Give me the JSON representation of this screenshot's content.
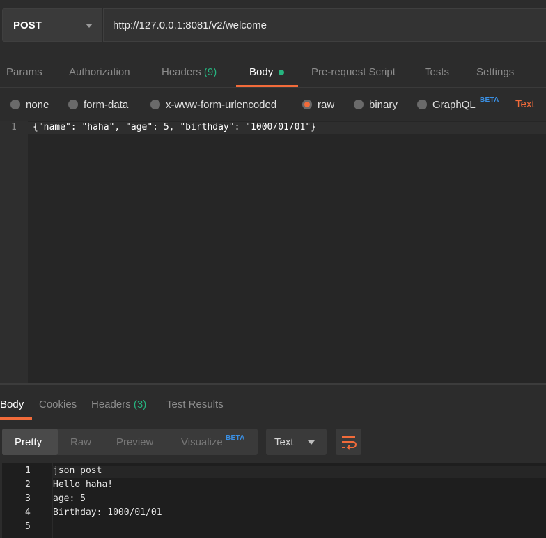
{
  "request": {
    "method": "POST",
    "url": "http://127.0.0.1:8081/v2/welcome"
  },
  "request_tabs": {
    "params": "Params",
    "authorization": "Authorization",
    "headers": "Headers",
    "headers_count": "(9)",
    "body": "Body",
    "prerequest": "Pre-request Script",
    "tests": "Tests",
    "settings": "Settings"
  },
  "body_modes": {
    "none": "none",
    "form_data": "form-data",
    "urlencoded": "x-www-form-urlencoded",
    "raw": "raw",
    "binary": "binary",
    "graphql": "GraphQL",
    "beta": "BETA",
    "selected": "raw",
    "raw_format": "Text"
  },
  "request_body": {
    "line_number": "1",
    "code": "{\"name\": \"haha\", \"age\": 5, \"birthday\": \"1000/01/01\"}"
  },
  "response_tabs": {
    "body": "Body",
    "cookies": "Cookies",
    "headers": "Headers",
    "headers_count": "(3)",
    "test_results": "Test Results"
  },
  "view_modes": {
    "pretty": "Pretty",
    "raw": "Raw",
    "preview": "Preview",
    "visualize": "Visualize",
    "beta": "BETA",
    "format": "Text"
  },
  "response_body": {
    "lines": [
      {
        "n": "1",
        "text": "json post"
      },
      {
        "n": "2",
        "text": "Hello haha!"
      },
      {
        "n": "3",
        "text": "age: 5"
      },
      {
        "n": "4",
        "text": "Birthday: 1000/01/01"
      },
      {
        "n": "5",
        "text": ""
      }
    ]
  },
  "colors": {
    "accent": "#f26b3a",
    "success": "#26b47f",
    "beta": "#3a8fe3",
    "background": "#2c2c2c"
  }
}
